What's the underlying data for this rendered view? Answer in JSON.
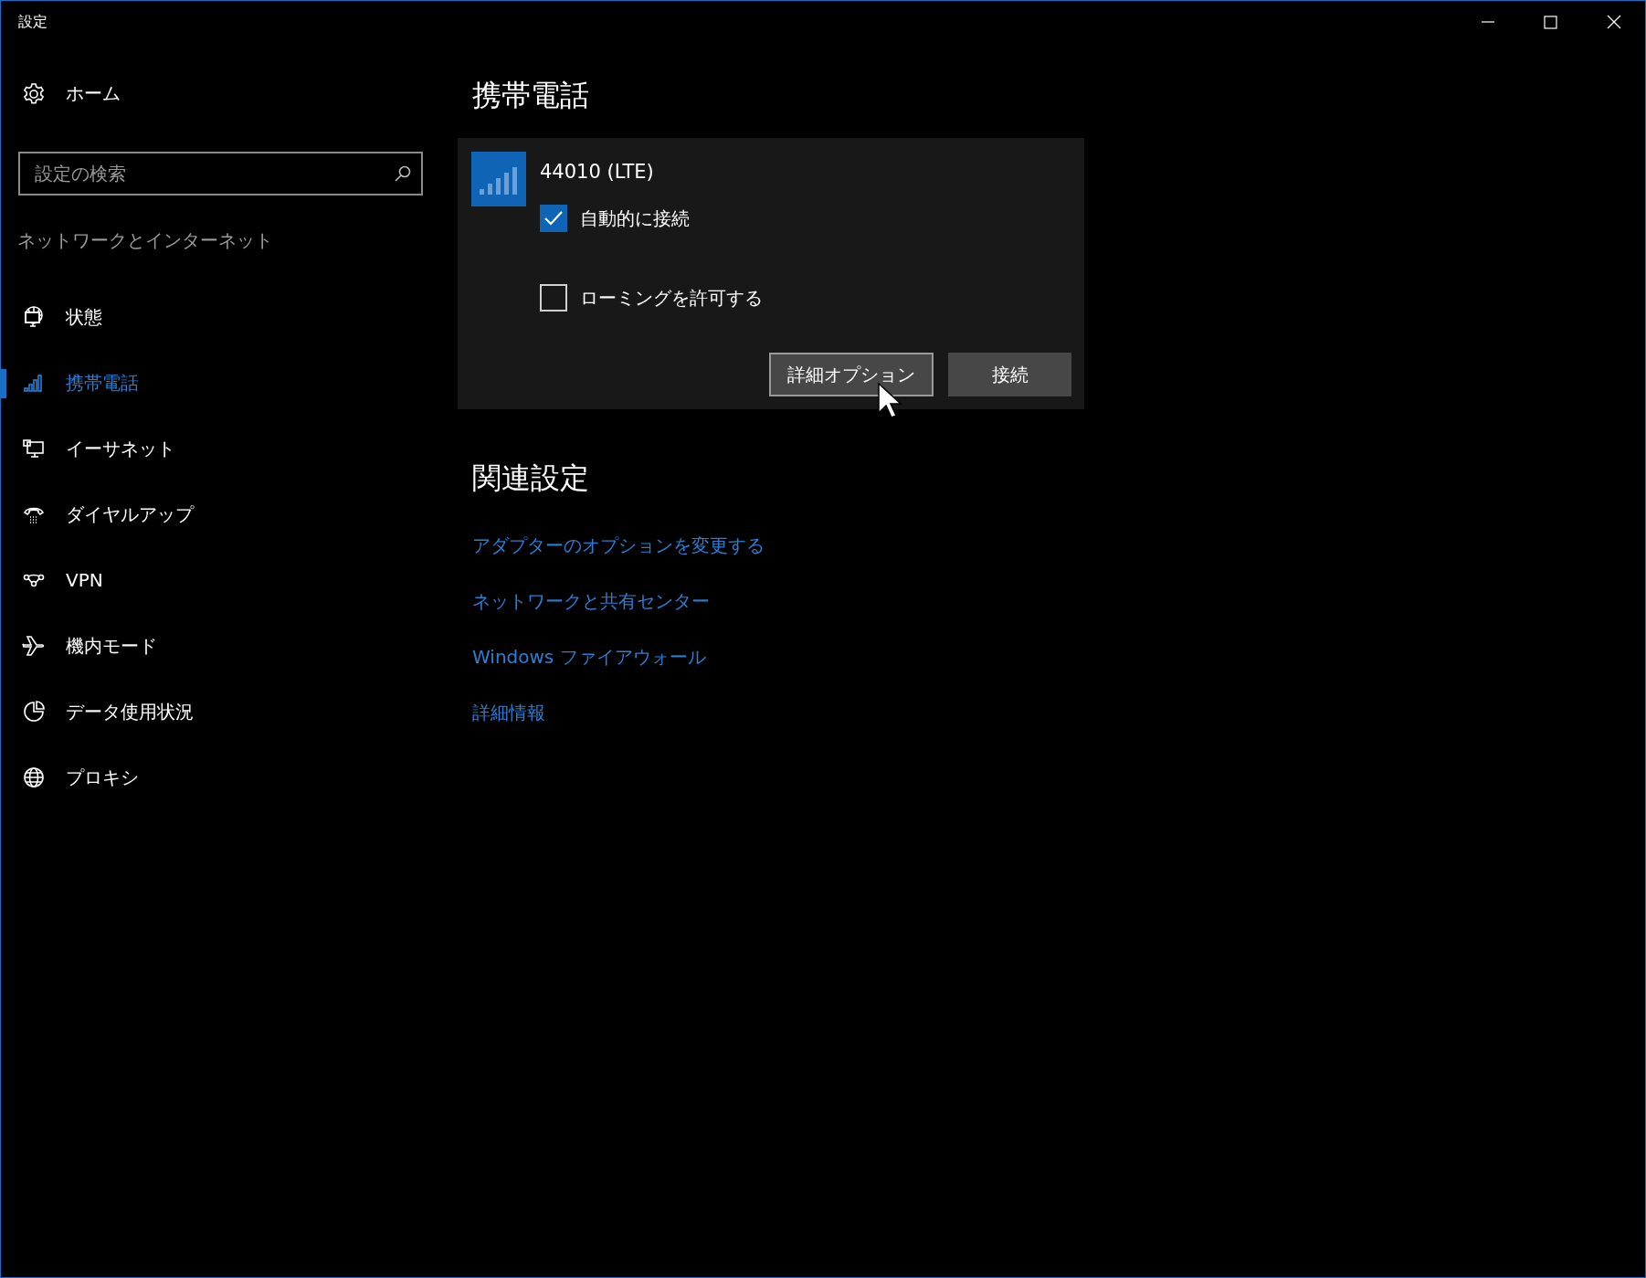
{
  "window": {
    "title": "設定"
  },
  "sidebar": {
    "home": "ホーム",
    "search": {
      "placeholder": "設定の検索"
    },
    "section": "ネットワークとインターネット",
    "items": [
      {
        "label": "状態",
        "selected": false
      },
      {
        "label": "携帯電話",
        "selected": true
      },
      {
        "label": "イーサネット",
        "selected": false
      },
      {
        "label": "ダイヤルアップ",
        "selected": false
      },
      {
        "label": "VPN",
        "selected": false
      },
      {
        "label": "機内モード",
        "selected": false
      },
      {
        "label": "データ使用状況",
        "selected": false
      },
      {
        "label": "プロキシ",
        "selected": false
      }
    ]
  },
  "main": {
    "title": "携帯電話",
    "network": {
      "name": "44010 (LTE)",
      "options": [
        {
          "label": "自動的に接続",
          "checked": true
        },
        {
          "label": "ローミングを許可する",
          "checked": false
        }
      ],
      "buttons": [
        {
          "label": "詳細オプション",
          "hovered": true
        },
        {
          "label": "接続",
          "hovered": false
        }
      ]
    },
    "related": {
      "title": "関連設定",
      "links": [
        "アダプターのオプションを変更する",
        "ネットワークと共有センター",
        "Windows ファイアウォール",
        "詳細情報"
      ]
    }
  }
}
